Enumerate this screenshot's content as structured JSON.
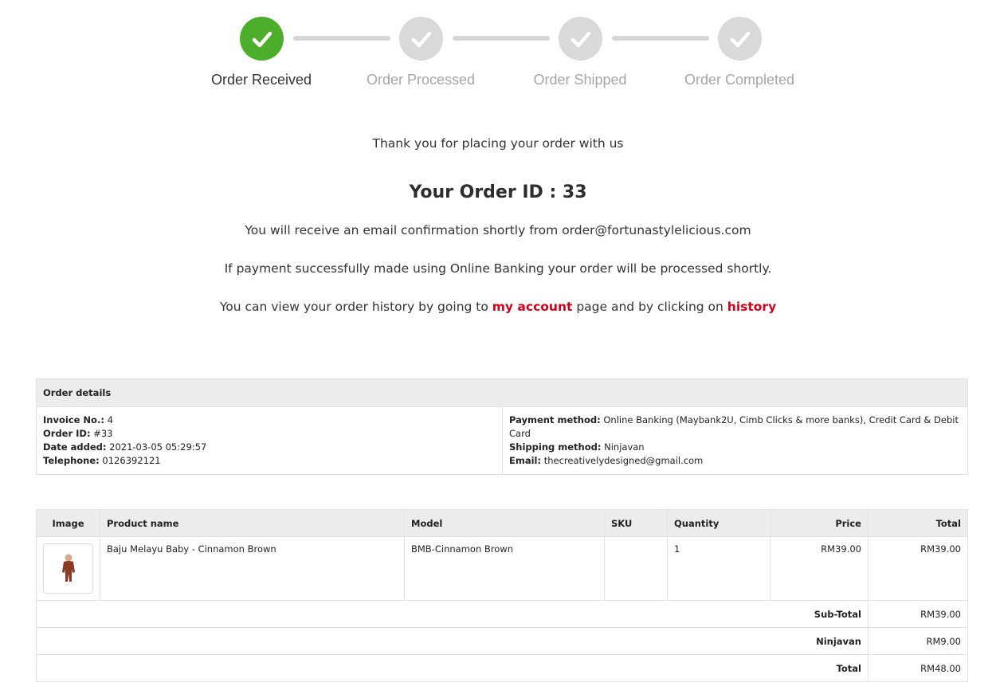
{
  "steps": [
    {
      "label": "Order Received",
      "status": "done"
    },
    {
      "label": "Order Processed",
      "status": "pending"
    },
    {
      "label": "Order Shipped",
      "status": "pending"
    },
    {
      "label": "Order Completed",
      "status": "pending"
    }
  ],
  "confirmation": {
    "thanks": "Thank you for placing your order with us",
    "order_id_label": "Your Order ID : 33",
    "email_note": "You will receive an email confirmation shortly from order@fortunastylelicious.com",
    "payment_note": "If payment successfully made using Online Banking your order will be processed shortly.",
    "history_prefix": "You can view your order history by going to",
    "account_link": "my account",
    "history_middle": "page and by clicking on",
    "history_link": "history"
  },
  "order_details": {
    "header": "Order details",
    "invoice_label": "Invoice No.:",
    "invoice_value": "4",
    "order_id_label": "Order ID:",
    "order_id_value": "#33",
    "date_label": "Date added:",
    "date_value": "2021-03-05 05:29:57",
    "phone_label": "Telephone:",
    "phone_value": "0126392121",
    "payment_label": "Payment method:",
    "payment_value": "Online Banking (Maybank2U, Cimb Clicks & more banks), Credit Card & Debit Card",
    "shipping_label": "Shipping method:",
    "shipping_value": "Ninjavan",
    "email_label": "Email:",
    "email_value": "thecreativelydesigned@gmail.com"
  },
  "products": {
    "headers": {
      "image": "Image",
      "name": "Product name",
      "model": "Model",
      "sku": "SKU",
      "quantity": "Quantity",
      "price": "Price",
      "total": "Total"
    },
    "rows": [
      {
        "name": "Baju Melayu Baby - Cinnamon Brown",
        "model": "BMB-Cinnamon Brown",
        "sku": "",
        "quantity": "1",
        "price": "RM39.00",
        "total": "RM39.00"
      }
    ],
    "totals": [
      {
        "label": "Sub-Total",
        "value": "RM39.00"
      },
      {
        "label": "Ninjavan",
        "value": "RM9.00"
      },
      {
        "label": "Total",
        "value": "RM48.00"
      }
    ]
  },
  "colors": {
    "success": "#4cae2a",
    "pending": "#d9d9d9",
    "link": "#d0021b"
  },
  "icons": {
    "step": "checkmark-icon",
    "product_image": "baby-outfit-thumbnail"
  }
}
